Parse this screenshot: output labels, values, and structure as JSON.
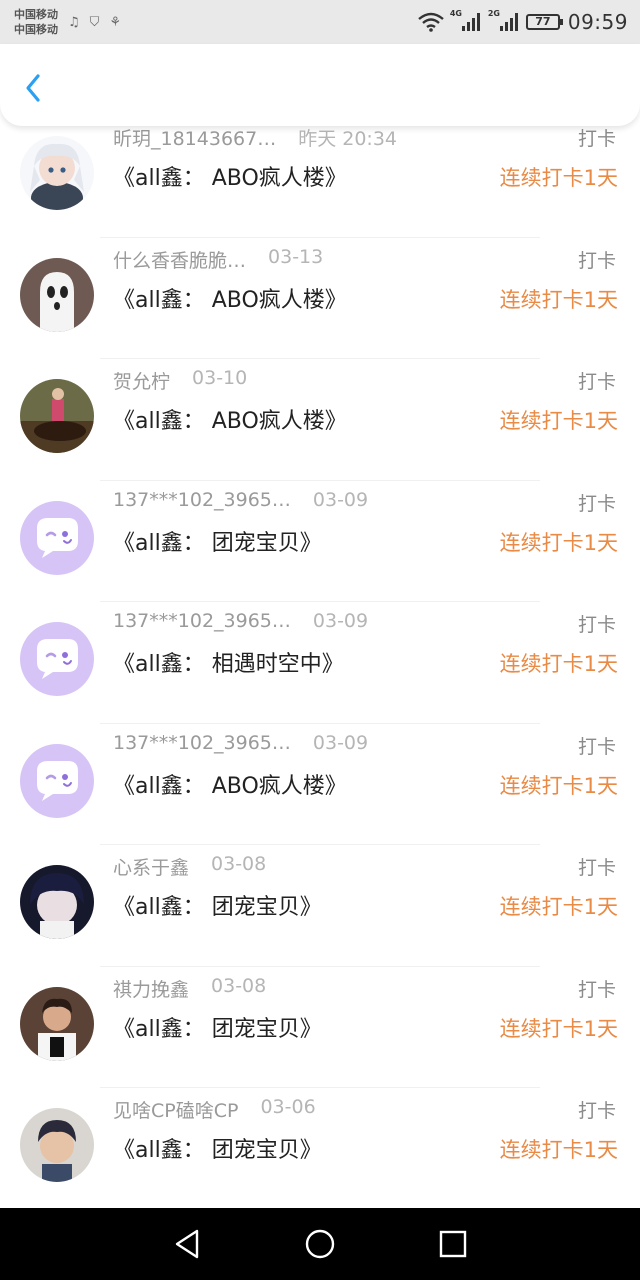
{
  "status_bar": {
    "carrier_1": "中国移动",
    "carrier_2": "中国移动",
    "net_1": "4G",
    "net_2": "2G",
    "battery": "77",
    "time": "09:59",
    "icons": [
      "music-icon",
      "shield-icon",
      "app-icon",
      "wifi-icon"
    ]
  },
  "header": {
    "back_icon": "chevron-left-icon",
    "accent": "#2b9ff0"
  },
  "list": {
    "items": [
      {
        "name": "昕玥_18143667…",
        "date": "昨天 20:34",
        "title": "《all鑫： ABO疯人楼》",
        "type": "打卡",
        "streak": "连续打卡1天",
        "avatar": "anime-girl"
      },
      {
        "name": "什么香香脆脆…",
        "date": "03-13",
        "title": "《all鑫： ABO疯人楼》",
        "type": "打卡",
        "streak": "连续打卡1天",
        "avatar": "ghost"
      },
      {
        "name": "贺允柠",
        "date": "03-10",
        "title": "《all鑫： ABO疯人楼》",
        "type": "打卡",
        "streak": "连续打卡1天",
        "avatar": "horse-rider"
      },
      {
        "name": "137***102_3965…",
        "date": "03-09",
        "title": "《all鑫： 团宠宝贝》",
        "type": "打卡",
        "streak": "连续打卡1天",
        "avatar": "default"
      },
      {
        "name": "137***102_3965…",
        "date": "03-09",
        "title": "《all鑫： 相遇时空中》",
        "type": "打卡",
        "streak": "连续打卡1天",
        "avatar": "default"
      },
      {
        "name": "137***102_3965…",
        "date": "03-09",
        "title": "《all鑫： ABO疯人楼》",
        "type": "打卡",
        "streak": "连续打卡1天",
        "avatar": "default"
      },
      {
        "name": "心系于鑫",
        "date": "03-08",
        "title": "《all鑫： 团宠宝贝》",
        "type": "打卡",
        "streak": "连续打卡1天",
        "avatar": "dark-hair"
      },
      {
        "name": "祺力挽鑫",
        "date": "03-08",
        "title": "《all鑫： 团宠宝贝》",
        "type": "打卡",
        "streak": "连续打卡1天",
        "avatar": "portrait"
      },
      {
        "name": "见啥CP磕啥CP",
        "date": "03-06",
        "title": "《all鑫： 团宠宝贝》",
        "type": "打卡",
        "streak": "连续打卡1天",
        "avatar": "boy-photo"
      }
    ]
  },
  "colors": {
    "streak": "#e98a45",
    "default_avatar": "#d6c4f6",
    "status_bar_bg": "#e9e9e9"
  },
  "navbar": {
    "icons": [
      "back-triangle-icon",
      "home-circle-icon",
      "recents-square-icon"
    ]
  }
}
